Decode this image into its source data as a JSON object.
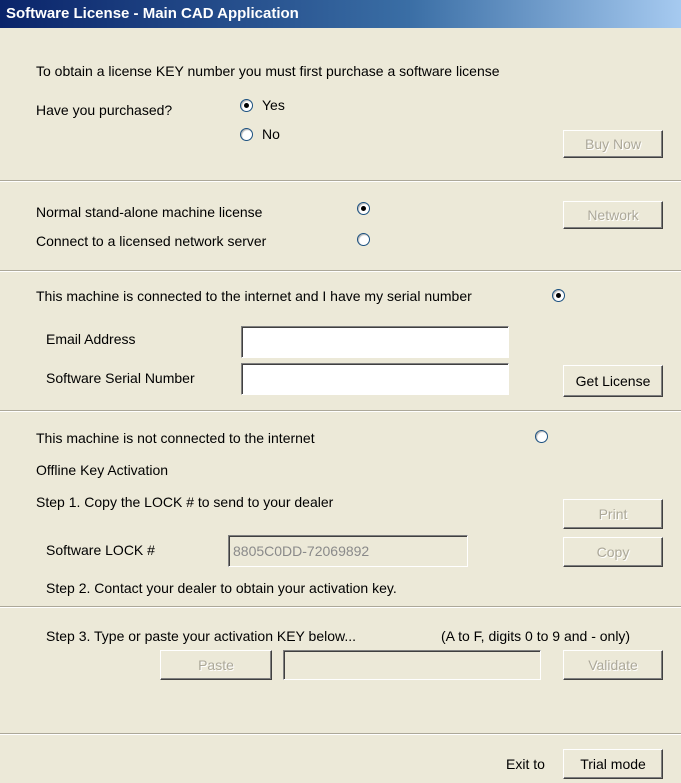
{
  "window": {
    "title": "Software License - Main CAD Application"
  },
  "purchase": {
    "intro": "To obtain a license KEY number you must first purchase a software license",
    "question": "Have you purchased?",
    "yes_label": "Yes",
    "no_label": "No",
    "buy_now_label": "Buy Now"
  },
  "license_type": {
    "standalone_label": "Normal stand-alone machine license",
    "network_server_label": "Connect to a licensed network server",
    "network_button_label": "Network"
  },
  "online": {
    "label": "This machine is connected to the internet and I have my serial number",
    "email_label": "Email Address",
    "email_value": "",
    "serial_label": "Software Serial Number",
    "serial_value": "",
    "get_license_label": "Get License"
  },
  "offline": {
    "label": "This machine is not connected to the internet",
    "heading": "Offline Key Activation",
    "step1": "Step 1.  Copy the LOCK # to send to your dealer",
    "print_label": "Print",
    "lock_label": "Software LOCK #",
    "lock_value": "8805C0DD-72069892",
    "copy_label": "Copy",
    "step2": "Step 2.  Contact your dealer to obtain your activation key."
  },
  "activation": {
    "step3": "Step 3.  Type or paste your activation KEY below...",
    "hint": "(A to F, digits 0 to 9 and - only)",
    "paste_label": "Paste",
    "key_value": "",
    "validate_label": "Validate"
  },
  "footer": {
    "exit_label": "Exit to",
    "trial_label": "Trial mode"
  }
}
